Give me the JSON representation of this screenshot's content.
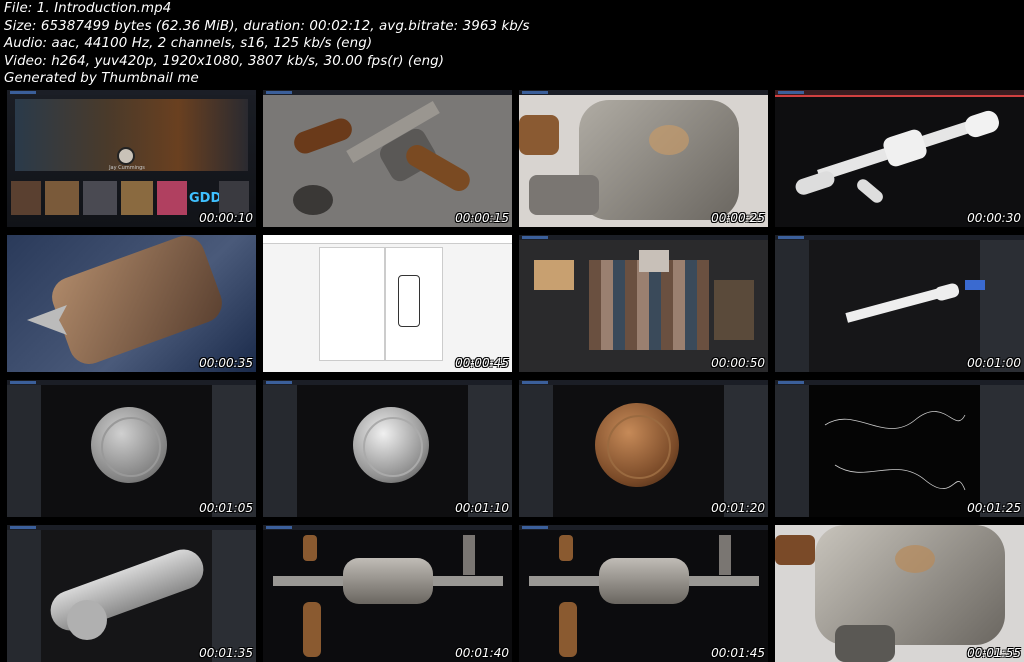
{
  "header": {
    "file": "File: 1. Introduction.mp4",
    "size": "Size: 65387499 bytes (62.36 MiB), duration: 00:02:12, avg.bitrate: 3963 kb/s",
    "audio": "Audio: aac, 44100 Hz, 2 channels, s16, 125 kb/s (eng)",
    "video": "Video: h264, yuv420p, 1920x1080, 3807 kb/s, 30.00 fps(r) (eng)",
    "generator": "Generated by Thumbnail me"
  },
  "thumbnails": [
    {
      "time": "00:00:10"
    },
    {
      "time": "00:00:15"
    },
    {
      "time": "00:00:25"
    },
    {
      "time": "00:00:30"
    },
    {
      "time": "00:00:35"
    },
    {
      "time": "00:00:45"
    },
    {
      "time": "00:00:50"
    },
    {
      "time": "00:01:00"
    },
    {
      "time": "00:01:05"
    },
    {
      "time": "00:01:10"
    },
    {
      "time": "00:01:20"
    },
    {
      "time": "00:01:25"
    },
    {
      "time": "00:01:35"
    },
    {
      "time": "00:01:40"
    },
    {
      "time": "00:01:45"
    },
    {
      "time": "00:01:55"
    }
  ],
  "cell_texts": {
    "profile_name": "Jay Cummings",
    "logo_text": "GDD"
  },
  "colors": {
    "background": "#000000",
    "text": "#ffffff",
    "app_bar": "#1b1e26",
    "wood": "#7a4a28",
    "metal": "#9a9a98"
  }
}
